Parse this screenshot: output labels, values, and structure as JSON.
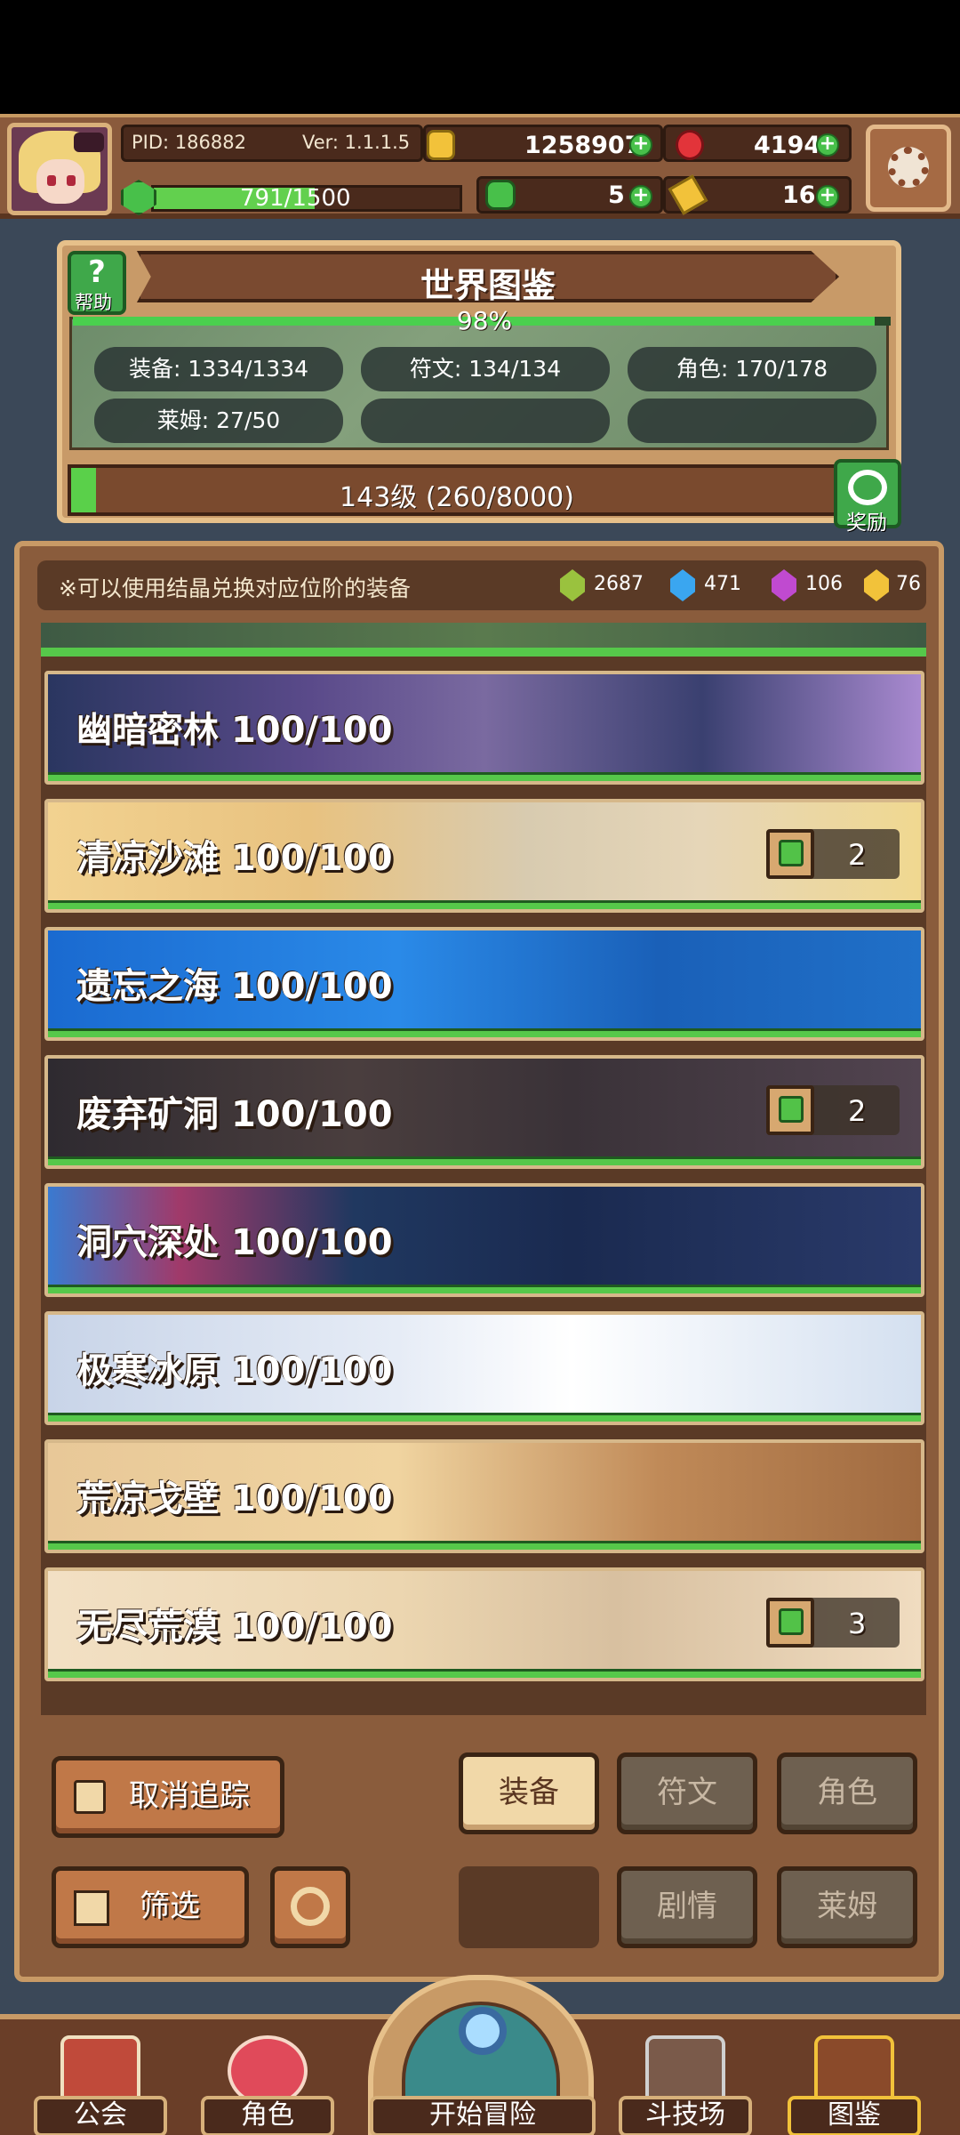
{
  "header": {
    "pid": "PID: 186882",
    "version": "Ver: 1.1.1.5",
    "gold": "1258907",
    "gems": "4194",
    "clover": "5",
    "keys": "16",
    "xp": "791/1500",
    "xp_progress": 0.527
  },
  "world": {
    "title": "世界图鉴",
    "help_label": "帮助",
    "percent": "98%",
    "percent_value": 0.98,
    "stats": [
      "装备: 1334/1334",
      "符文: 134/134",
      "角色: 170/178",
      "莱姆: 27/50"
    ],
    "level_text": "143级 (260/8000)",
    "level_progress": 0.0325,
    "reward_label": "奖励"
  },
  "info": {
    "notice": "※可以使用结晶兑换对应位阶的装备",
    "crystals": [
      {
        "color": "#9ac23e",
        "count": "2687"
      },
      {
        "color": "#3aa6f0",
        "count": "471"
      },
      {
        "color": "#c04ad0",
        "count": "106"
      },
      {
        "color": "#f2c23a",
        "count": "76"
      }
    ]
  },
  "areas": [
    {
      "name": "幽暗密林",
      "progress": "100/100",
      "likes": ""
    },
    {
      "name": "清凉沙滩",
      "progress": "100/100",
      "likes": "2"
    },
    {
      "name": "遗忘之海",
      "progress": "100/100",
      "likes": ""
    },
    {
      "name": "废弃矿洞",
      "progress": "100/100",
      "likes": "2"
    },
    {
      "name": "洞穴深处",
      "progress": "100/100",
      "likes": ""
    },
    {
      "name": "极寒冰原",
      "progress": "100/100",
      "likes": ""
    },
    {
      "name": "荒凉戈壁",
      "progress": "100/100",
      "likes": ""
    },
    {
      "name": "无尽荒漠",
      "progress": "100/100",
      "likes": "3"
    }
  ],
  "controls": {
    "untrack": "取消追踪",
    "filter": "筛选",
    "tab_equipment": "装备",
    "tab_rune": "符文",
    "tab_character": "角色",
    "tab_story": "剧情",
    "tab_slime": "莱姆"
  },
  "nav": {
    "guild": "公会",
    "character": "角色",
    "adventure": "开始冒险",
    "arena": "斗技场",
    "codex": "图鉴"
  }
}
